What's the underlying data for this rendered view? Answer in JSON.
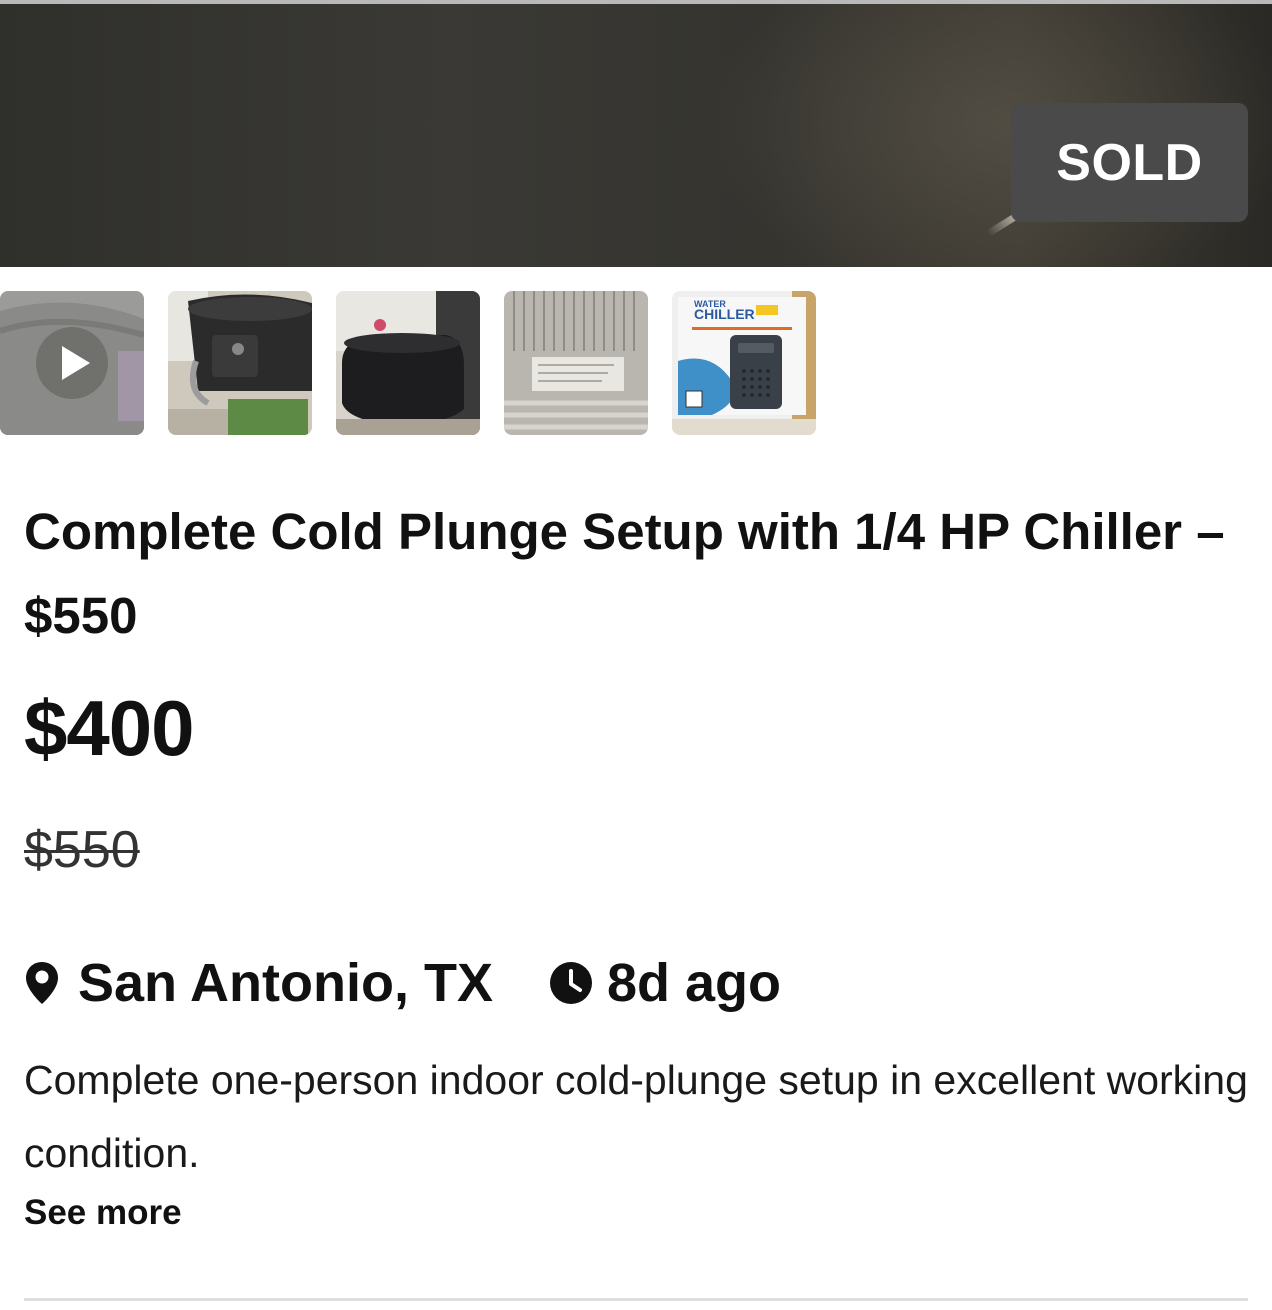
{
  "listing": {
    "status_badge": "SOLD",
    "title": "Complete Cold Plunge Setup with 1/4 HP Chiller – $550",
    "price": "$400",
    "original_price": "$550",
    "location": "San Antonio, TX",
    "posted": "8d ago",
    "description": "Complete one-person indoor cold-plunge setup in excellent working condition.",
    "see_more_label": "See more"
  },
  "gallery": {
    "thumbnails": [
      {
        "kind": "video",
        "icon": "play-icon"
      },
      {
        "kind": "photo"
      },
      {
        "kind": "photo"
      },
      {
        "kind": "photo"
      },
      {
        "kind": "photo",
        "caption": "WATER CHILLER"
      }
    ]
  },
  "icons": {
    "location": "map-pin-icon",
    "time": "clock-icon"
  },
  "colors": {
    "badge_bg": "#4a4a4a",
    "text": "#111111",
    "divider": "#dedede"
  }
}
